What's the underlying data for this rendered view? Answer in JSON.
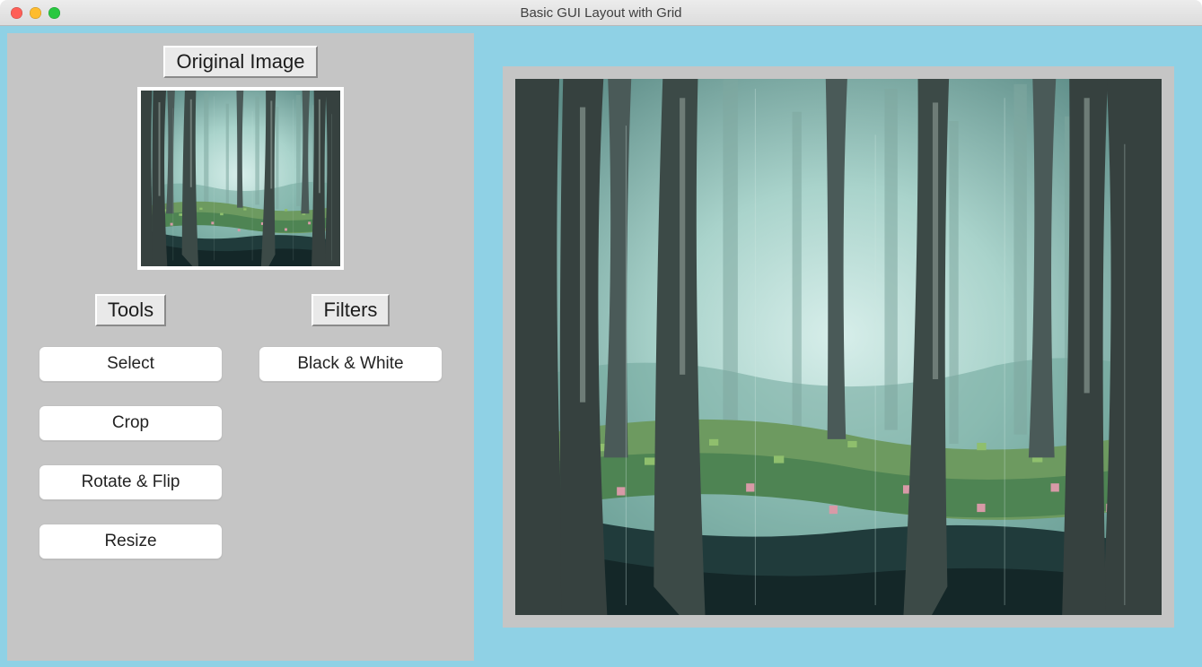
{
  "window": {
    "title": "Basic GUI Layout with Grid"
  },
  "left": {
    "originalLabel": "Original Image",
    "toolsLabel": "Tools",
    "filtersLabel": "Filters",
    "toolButtons": [
      "Select",
      "Crop",
      "Rotate & Flip",
      "Resize"
    ],
    "filterButtons": [
      "Black & White"
    ]
  },
  "image": {
    "alt": "forest-pixel-art"
  }
}
